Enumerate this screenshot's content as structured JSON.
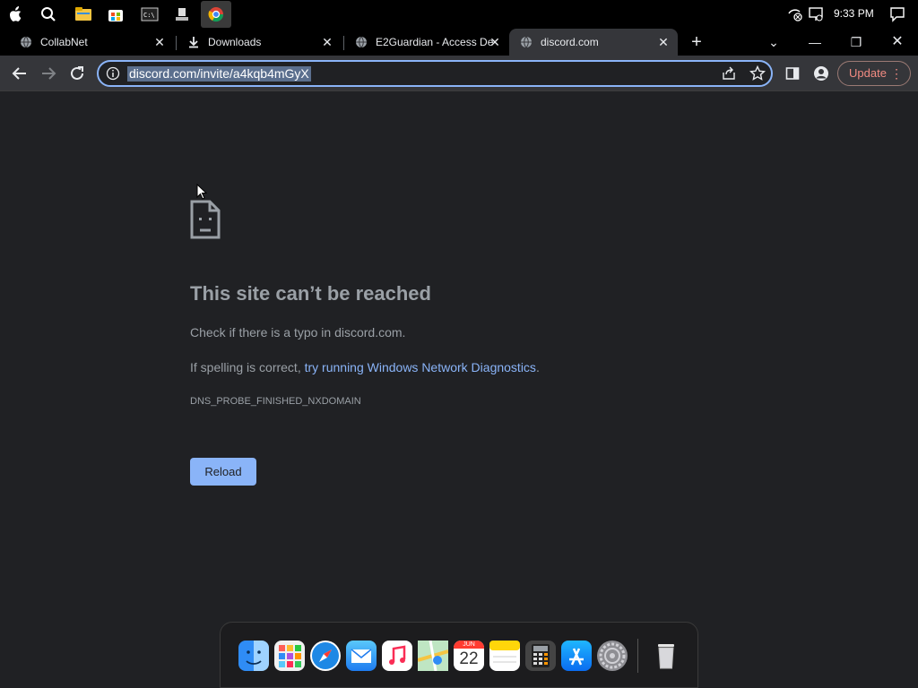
{
  "tabs": [
    {
      "label": "CollabNet",
      "favicon": "globe-icon"
    },
    {
      "label": "Downloads",
      "favicon": "download-icon"
    },
    {
      "label": "E2Guardian - Access De",
      "favicon": "globe-icon"
    },
    {
      "label": "discord.com",
      "favicon": "globe-icon"
    }
  ],
  "system": {
    "time": "9:33 PM"
  },
  "toolbar": {
    "url": "discord.com/invite/a4kqb4mGyX",
    "update_label": "Update"
  },
  "error": {
    "title": "This site can’t be reached",
    "line1": "Check if there is a typo in discord.com.",
    "line2_prefix": "If spelling is correct, ",
    "line2_link": "try running Windows Network Diagnostics",
    "line2_suffix": ".",
    "code": "DNS_PROBE_FINISHED_NXDOMAIN",
    "reload_label": "Reload"
  },
  "dock": {
    "calendar_month": "JUN",
    "calendar_day": "22",
    "apps": [
      "finder",
      "launchpad",
      "safari",
      "mail",
      "music",
      "maps",
      "calendar",
      "notes",
      "calculator",
      "app-store",
      "system-preferences",
      "trash"
    ]
  },
  "colors": {
    "accent": "#8ab4f8",
    "background": "#202124",
    "update": "#f28b82"
  }
}
